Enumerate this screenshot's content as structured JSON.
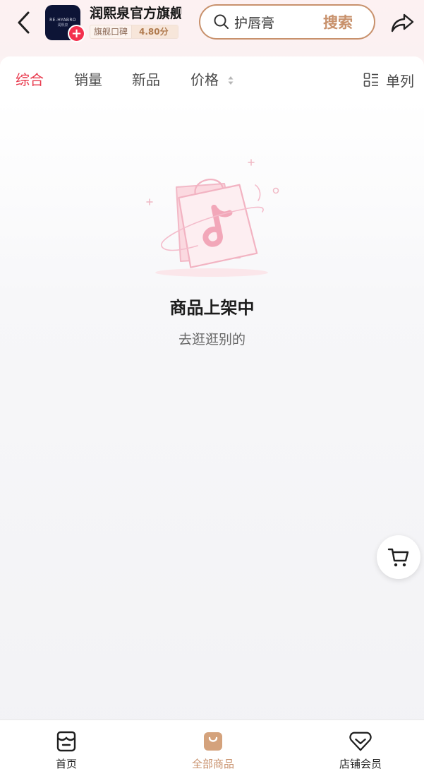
{
  "header": {
    "store_name": "润熙泉官方旗舰",
    "logo_text": "RE-HYABRO",
    "logo_subtext": "润熙泉",
    "follow_symbol": "+",
    "rating_label": "旗舰口碑",
    "rating_value": "4.80分",
    "search": {
      "query": "护唇膏",
      "button_label": "搜索"
    }
  },
  "sort_bar": {
    "items": [
      {
        "label": "综合",
        "active": true
      },
      {
        "label": "销量",
        "active": false
      },
      {
        "label": "新品",
        "active": false
      },
      {
        "label": "价格",
        "active": false
      }
    ],
    "layout_label": "单列"
  },
  "empty_state": {
    "title": "商品上架中",
    "subtitle": "去逛逛别的"
  },
  "bottom_nav": {
    "items": [
      {
        "label": "首页",
        "icon": "store-home-icon",
        "active": false
      },
      {
        "label": "全部商品",
        "icon": "shopping-bag-icon",
        "active": true
      },
      {
        "label": "店铺会员",
        "icon": "member-heart-icon",
        "active": false
      }
    ]
  },
  "colors": {
    "accent_red": "#e8394d",
    "accent_gold": "#c8916c",
    "follow_red": "#f3304e",
    "text_dark": "#1f1f1f"
  }
}
